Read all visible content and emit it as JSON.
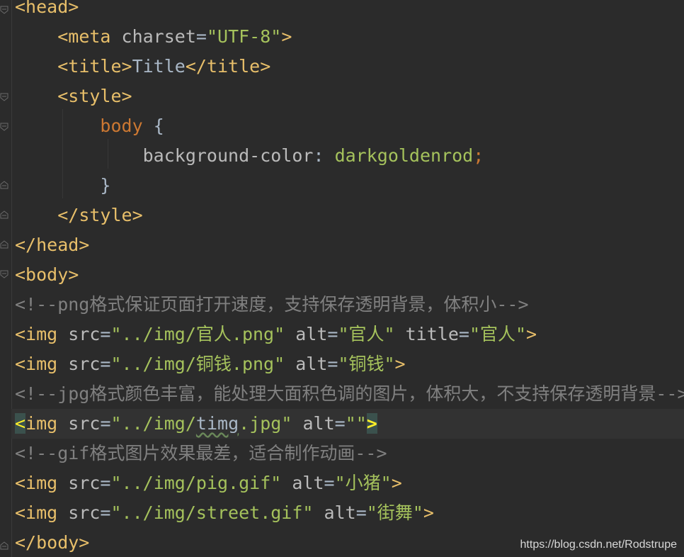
{
  "editor": {
    "lines": [
      {
        "tokens": [
          [
            "tag",
            "<head>"
          ]
        ]
      },
      {
        "tokens": [
          [
            "txt",
            "    "
          ],
          [
            "tag",
            "<meta "
          ],
          [
            "attr",
            "charset"
          ],
          [
            "txt",
            "="
          ],
          [
            "str",
            "\"UTF-8\""
          ],
          [
            "tag",
            ">"
          ]
        ]
      },
      {
        "tokens": [
          [
            "txt",
            "    "
          ],
          [
            "tag",
            "<title>"
          ],
          [
            "txt",
            "Title"
          ],
          [
            "tag",
            "</title>"
          ]
        ]
      },
      {
        "tokens": [
          [
            "txt",
            "    "
          ],
          [
            "tag",
            "<style>"
          ]
        ]
      },
      {
        "tokens": [
          [
            "txt",
            "        "
          ],
          [
            "sel",
            "body"
          ],
          [
            "punct",
            " {"
          ]
        ]
      },
      {
        "tokens": [
          [
            "txt",
            "            "
          ],
          [
            "prop",
            "background-color"
          ],
          [
            "punct",
            ": "
          ],
          [
            "val",
            "darkgoldenrod"
          ],
          [
            "semi",
            ";"
          ]
        ]
      },
      {
        "tokens": [
          [
            "txt",
            "        "
          ],
          [
            "punct",
            "}"
          ]
        ]
      },
      {
        "tokens": [
          [
            "txt",
            "    "
          ],
          [
            "tag",
            "</style>"
          ]
        ]
      },
      {
        "tokens": [
          [
            "tag",
            "</head>"
          ]
        ]
      },
      {
        "tokens": [
          [
            "tag",
            "<body>"
          ]
        ]
      },
      {
        "tokens": [
          [
            "cmt",
            "<!--png格式保证页面打开速度，支持保存透明背景，体积小-->"
          ]
        ]
      },
      {
        "tokens": [
          [
            "tag",
            "<img "
          ],
          [
            "attr",
            "src"
          ],
          [
            "txt",
            "="
          ],
          [
            "str",
            "\"../img/官人.png\""
          ],
          [
            "txt",
            " "
          ],
          [
            "attr",
            "alt"
          ],
          [
            "txt",
            "="
          ],
          [
            "str",
            "\"官人\""
          ],
          [
            "txt",
            " "
          ],
          [
            "attr",
            "title"
          ],
          [
            "txt",
            "="
          ],
          [
            "str",
            "\"官人\""
          ],
          [
            "tag",
            ">"
          ]
        ]
      },
      {
        "tokens": [
          [
            "tag",
            "<img "
          ],
          [
            "attr",
            "src"
          ],
          [
            "txt",
            "="
          ],
          [
            "str",
            "\"../img/铜钱.png\""
          ],
          [
            "txt",
            " "
          ],
          [
            "attr",
            "alt"
          ],
          [
            "txt",
            "="
          ],
          [
            "str",
            "\"铜钱\""
          ],
          [
            "tag",
            ">"
          ]
        ]
      },
      {
        "tokens": [
          [
            "cmt",
            "<!--jpg格式颜色丰富，能处理大面积色调的图片，体积大，不支持保存透明背景-->"
          ]
        ]
      },
      {
        "tokens": [
          [
            "match-left",
            "<"
          ],
          [
            "tag",
            "img "
          ],
          [
            "attr",
            "src"
          ],
          [
            "txt",
            "="
          ],
          [
            "str",
            "\"../img/"
          ],
          [
            "typo",
            "timg"
          ],
          [
            "str",
            ".jpg\""
          ],
          [
            "txt",
            " "
          ],
          [
            "attr",
            "alt"
          ],
          [
            "txt",
            "="
          ],
          [
            "str",
            "\"\""
          ],
          [
            "match",
            ">"
          ]
        ],
        "current": true
      },
      {
        "tokens": [
          [
            "cmt",
            "<!--gif格式图片效果最差，适合制作动画-->"
          ]
        ]
      },
      {
        "tokens": [
          [
            "tag",
            "<img "
          ],
          [
            "attr",
            "src"
          ],
          [
            "txt",
            "="
          ],
          [
            "str",
            "\"../img/pig.gif\""
          ],
          [
            "txt",
            " "
          ],
          [
            "attr",
            "alt"
          ],
          [
            "txt",
            "="
          ],
          [
            "str",
            "\"小猪\""
          ],
          [
            "tag",
            ">"
          ]
        ]
      },
      {
        "tokens": [
          [
            "tag",
            "<img "
          ],
          [
            "attr",
            "src"
          ],
          [
            "txt",
            "="
          ],
          [
            "str",
            "\"../img/street.gif\""
          ],
          [
            "txt",
            " "
          ],
          [
            "attr",
            "alt"
          ],
          [
            "txt",
            "="
          ],
          [
            "str",
            "\"街舞\""
          ],
          [
            "tag",
            ">"
          ]
        ]
      },
      {
        "tokens": [
          [
            "tag",
            "</body>"
          ]
        ]
      }
    ]
  },
  "watermark": "https://blog.csdn.net/Rodstrupe",
  "colors": {
    "background": "#2b2b2b",
    "tag": "#e8bf6a",
    "string": "#a5c25c",
    "comment": "#808080",
    "selector": "#cc7832",
    "text": "#a9b7c6",
    "current_line": "#323232",
    "brace_match": "#3b514d"
  },
  "gutter_icons": [
    "fold-icon",
    "fold-icon",
    "fold-icon",
    "fold-icon",
    "fold-icon",
    "fold-icon",
    "fold-icon",
    "fold-icon",
    "fold-icon",
    "fold-icon"
  ]
}
